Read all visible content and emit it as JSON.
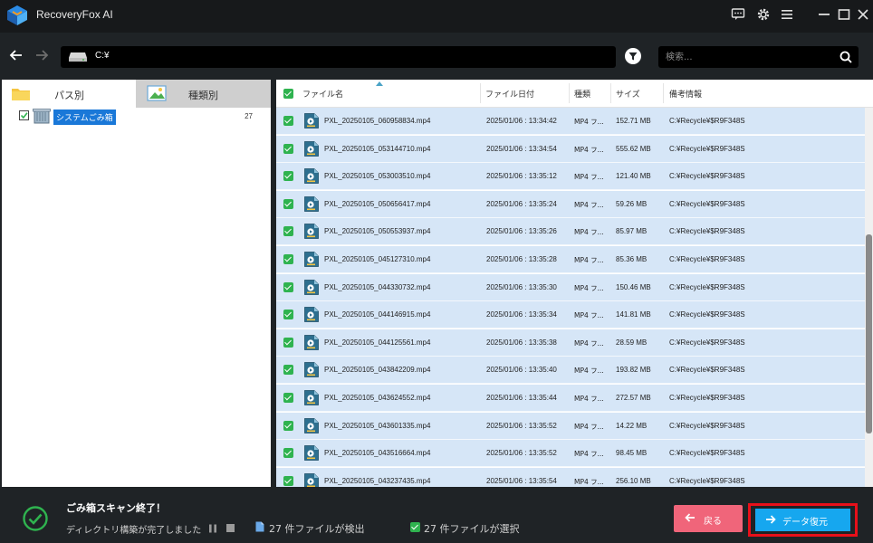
{
  "app": {
    "title": "RecoveryFox AI"
  },
  "titlebar": {
    "icons": [
      "feedback-icon",
      "gear-icon",
      "menu-icon",
      "minimize-icon",
      "maximize-icon",
      "close-icon"
    ]
  },
  "toolbar": {
    "path": "C:¥",
    "search_placeholder": "検索..."
  },
  "left_panel": {
    "tabs": [
      {
        "label": "パス別"
      },
      {
        "label": "種類別"
      }
    ],
    "tree": [
      {
        "label": "システムごみ箱",
        "count": "27",
        "checked": true
      }
    ]
  },
  "file_list": {
    "headers": {
      "name": "ファイル名",
      "date": "ファイル日付",
      "type": "種類",
      "size": "サイズ",
      "note": "備考情報"
    },
    "rows": [
      {
        "name": "PXL_20250105_060958834.mp4",
        "date": "2025/01/06 : 13:34:42",
        "type": "MP4 フ...",
        "size": "152.71 MB",
        "note": "C:¥Recycle¥$R9F348S"
      },
      {
        "name": "PXL_20250105_053144710.mp4",
        "date": "2025/01/06 : 13:34:54",
        "type": "MP4 フ...",
        "size": "555.62 MB",
        "note": "C:¥Recycle¥$R9F348S"
      },
      {
        "name": "PXL_20250105_053003510.mp4",
        "date": "2025/01/06 : 13:35:12",
        "type": "MP4 フ...",
        "size": "121.40 MB",
        "note": "C:¥Recycle¥$R9F348S"
      },
      {
        "name": "PXL_20250105_050656417.mp4",
        "date": "2025/01/06 : 13:35:24",
        "type": "MP4 フ...",
        "size": "59.26 MB",
        "note": "C:¥Recycle¥$R9F348S"
      },
      {
        "name": "PXL_20250105_050553937.mp4",
        "date": "2025/01/06 : 13:35:26",
        "type": "MP4 フ...",
        "size": "85.97 MB",
        "note": "C:¥Recycle¥$R9F348S"
      },
      {
        "name": "PXL_20250105_045127310.mp4",
        "date": "2025/01/06 : 13:35:28",
        "type": "MP4 フ...",
        "size": "85.36 MB",
        "note": "C:¥Recycle¥$R9F348S"
      },
      {
        "name": "PXL_20250105_044330732.mp4",
        "date": "2025/01/06 : 13:35:30",
        "type": "MP4 フ...",
        "size": "150.46 MB",
        "note": "C:¥Recycle¥$R9F348S"
      },
      {
        "name": "PXL_20250105_044146915.mp4",
        "date": "2025/01/06 : 13:35:34",
        "type": "MP4 フ...",
        "size": "141.81 MB",
        "note": "C:¥Recycle¥$R9F348S"
      },
      {
        "name": "PXL_20250105_044125561.mp4",
        "date": "2025/01/06 : 13:35:38",
        "type": "MP4 フ...",
        "size": "28.59 MB",
        "note": "C:¥Recycle¥$R9F348S"
      },
      {
        "name": "PXL_20250105_043842209.mp4",
        "date": "2025/01/06 : 13:35:40",
        "type": "MP4 フ...",
        "size": "193.82 MB",
        "note": "C:¥Recycle¥$R9F348S"
      },
      {
        "name": "PXL_20250105_043624552.mp4",
        "date": "2025/01/06 : 13:35:44",
        "type": "MP4 フ...",
        "size": "272.57 MB",
        "note": "C:¥Recycle¥$R9F348S"
      },
      {
        "name": "PXL_20250105_043601335.mp4",
        "date": "2025/01/06 : 13:35:52",
        "type": "MP4 フ...",
        "size": "14.22 MB",
        "note": "C:¥Recycle¥$R9F348S"
      },
      {
        "name": "PXL_20250105_043516664.mp4",
        "date": "2025/01/06 : 13:35:52",
        "type": "MP4 フ...",
        "size": "98.45 MB",
        "note": "C:¥Recycle¥$R9F348S"
      },
      {
        "name": "PXL_20250105_043237435.mp4",
        "date": "2025/01/06 : 13:35:54",
        "type": "MP4 フ...",
        "size": "256.10 MB",
        "note": "C:¥Recycle¥$R9F348S"
      }
    ]
  },
  "status": {
    "title": "ごみ箱スキャン終了！",
    "subtitle": "ディレクトリ構築が完了しました",
    "found": "27 件ファイルが検出",
    "selected": "27 件ファイルが選択"
  },
  "actions": {
    "back_label": "戻る",
    "recover_label": "データ復元"
  },
  "colors": {
    "accent": "#16a7ef",
    "back": "#f0657a",
    "highlight": "#e8101a",
    "check": "#2fb34f",
    "row": "#d6e6f7"
  }
}
